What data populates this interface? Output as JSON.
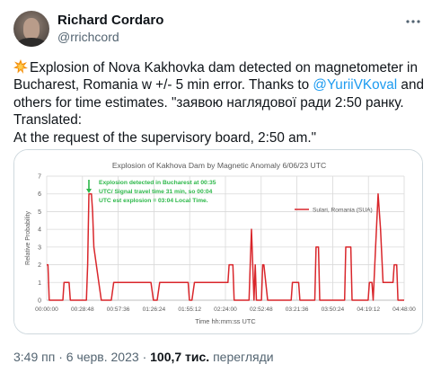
{
  "author": {
    "display_name": "Richard Cordaro",
    "handle": "@rrichcord"
  },
  "tweet": {
    "lines": [
      {
        "parts": [
          {
            "text": "Explosion of Nova Kakhovka dam detected on magnetometer in"
          }
        ]
      },
      {
        "parts": [
          {
            "text": "Bucharest, Romania w +/- 5 min error.  Thanks to "
          },
          {
            "text": "@YuriiVKoval",
            "mention": true
          },
          {
            "text": " and"
          }
        ]
      },
      {
        "parts": [
          {
            "text": "others for time estimates.  \"заявою наглядової ради 2:50 ранку."
          }
        ]
      },
      {
        "parts": [
          {
            "text": "Translated:"
          }
        ]
      },
      {
        "parts": [
          {
            "text": "At the request of the supervisory board, 2:50 am.\""
          }
        ]
      }
    ],
    "emoji_icon": "collision-icon"
  },
  "meta": {
    "time": "3:49 пп",
    "separator": "·",
    "date": "6 черв. 2023",
    "views_count": "100,7 тис.",
    "views_label": "перегляди"
  },
  "chart_data": {
    "type": "line",
    "title": "Explosion of Kakhova Dam by Magnetic Anomaly 6/06/23 UTC",
    "xlabel": "Time hh:mm:ss UTC",
    "ylabel": "Relative Probability",
    "ylim": [
      0,
      7
    ],
    "yticks": [
      0,
      1,
      2,
      3,
      4,
      5,
      6,
      7
    ],
    "xticks": [
      "00:00:00",
      "00:28:48",
      "00:57:36",
      "01:26:24",
      "01:55:12",
      "02:24:00",
      "02:52:48",
      "03:21:36",
      "03:50:24",
      "04:19:12",
      "04:48:00"
    ],
    "xlim_minutes": [
      0,
      288
    ],
    "grid": true,
    "legend_position": "right",
    "colors": {
      "series": "#d9262b",
      "annotation": "#2db84a",
      "grid": "#d9d9d9",
      "axis_text": "#595959"
    },
    "annotation": {
      "lines": [
        "Explosion detected in Bucharest at 00:35",
        "UTC/  Signal travel time 31 min, so 00:04",
        "UTC est explosion = 03:04 Local Time."
      ],
      "arrow_x_minutes": 34
    },
    "series": [
      {
        "name": "Sulari, Romania (SUA)",
        "x": [
          0,
          1,
          2,
          13,
          14,
          18,
          19,
          32,
          33,
          34,
          36,
          37,
          38,
          42,
          44,
          52,
          54,
          84,
          86,
          89,
          91,
          114,
          115,
          117,
          119,
          146,
          147,
          150,
          151,
          163,
          164,
          165,
          166,
          167,
          168,
          169,
          173,
          174,
          175,
          178,
          179,
          197,
          198,
          203,
          204,
          216,
          217,
          219,
          220,
          240,
          241,
          245,
          246,
          259,
          260,
          262,
          263,
          265,
          267,
          269,
          271,
          279,
          280,
          282,
          283,
          288
        ],
        "y": [
          2,
          2,
          0,
          0,
          1,
          1,
          0,
          0,
          2,
          6,
          6,
          5,
          3,
          1,
          0,
          0,
          1,
          1,
          0,
          0,
          1,
          1,
          0,
          0,
          1,
          1,
          2,
          2,
          0,
          0,
          2,
          4,
          2,
          0,
          2,
          0,
          0,
          2,
          2,
          0,
          0,
          0,
          1,
          1,
          0,
          0,
          3,
          3,
          0,
          0,
          3,
          3,
          0,
          0,
          1,
          1,
          0,
          3,
          6,
          4,
          1,
          1,
          2,
          2,
          0,
          0
        ]
      }
    ]
  }
}
